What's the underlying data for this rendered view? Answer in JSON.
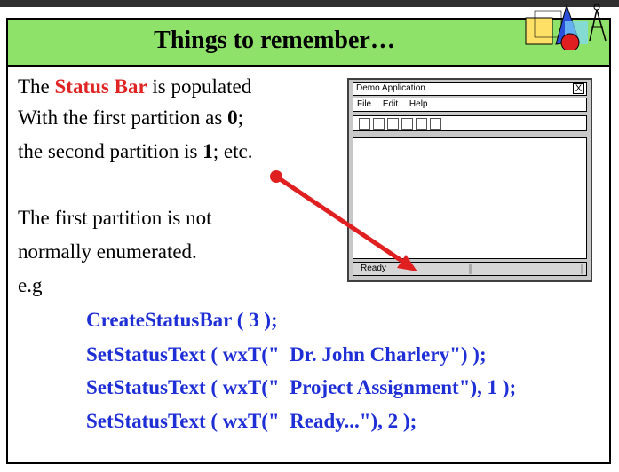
{
  "slide": {
    "title": "Things to remember…",
    "lines": {
      "l1_a": "The ",
      "l1_red": "Status Bar",
      "l1_b": " is populated",
      "l2_a": "With the first partition as ",
      "l2_bold": "0",
      "l2_b": ";",
      "l3_a": "the second partition is ",
      "l3_bold": "1",
      "l3_b": "; etc.",
      "l4": "The first partition is not",
      "l5": "normally enumerated.",
      "l6": "e.g"
    },
    "code": [
      "CreateStatusBar ( 3 );",
      "SetStatusText ( wxT(\"  Dr. John Charlery\") );",
      "SetStatusText ( wxT(\"  Project Assignment\"), 1 );",
      "SetStatusText ( wxT(\"  Ready...\"), 2 );"
    ]
  },
  "demo_window": {
    "title": "Demo Application",
    "close_glyph": "X",
    "menu": [
      "File",
      "Edit",
      "Help"
    ],
    "status_text": "Ready"
  },
  "colors": {
    "title_bg": "#8ee26a",
    "highlight": "#e02424",
    "code": "#1f2fd6"
  },
  "icons": [
    "geometry-shapes-icon",
    "compass-icon"
  ]
}
